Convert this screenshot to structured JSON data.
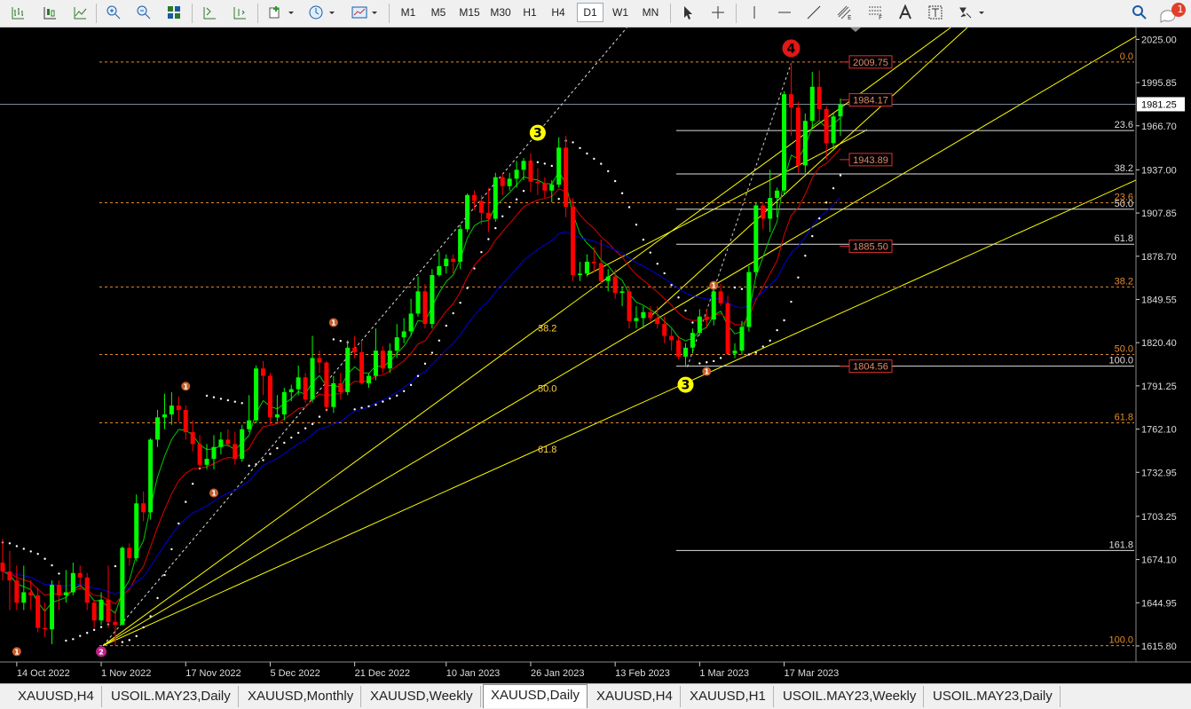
{
  "toolbar": {
    "timeframes": [
      "M1",
      "M5",
      "M15",
      "M30",
      "H1",
      "H4",
      "D1",
      "W1",
      "MN"
    ],
    "active_timeframe": "D1",
    "notification_count": "1",
    "icons": [
      "bar-chart-icon",
      "candle-chart-icon",
      "line-chart-icon",
      "zoom-in-icon",
      "zoom-out-icon",
      "tile-windows-icon",
      "auto-scroll-icon",
      "chart-shift-icon",
      "indicators-icon",
      "periodicity-icon",
      "templates-icon",
      "cursor-icon",
      "crosshair-icon",
      "vertical-line-icon",
      "horizontal-line-icon",
      "trendline-icon",
      "equidistant-channel-icon",
      "fibonacci-icon",
      "text-icon",
      "text-label-icon",
      "shapes-icon",
      "search-icon",
      "notification-icon"
    ]
  },
  "chart": {
    "colors": {
      "background": "#000000",
      "bull": "#00ff00",
      "bear": "#ff0000",
      "ma_fast": "#00cc00",
      "ma_mid": "#e00000",
      "ma_slow": "#0000dd",
      "trendline": "#ffff00",
      "fib": "#e38a2c",
      "sar": "#ffffff"
    },
    "price_axis": [
      "2025.00",
      "1995.85",
      "1966.70",
      "1937.00",
      "1907.85",
      "1878.70",
      "1849.55",
      "1820.40",
      "1791.25",
      "1762.10",
      "1732.95",
      "1703.25",
      "1674.10",
      "1644.95",
      "1615.80"
    ],
    "current_price": "1981.25",
    "date_axis": [
      "14 Oct 2022",
      "1 Nov 2022",
      "17 Nov 2022",
      "5 Dec 2022",
      "21 Dec 2022",
      "10 Jan 2023",
      "26 Jan 2023",
      "13 Feb 2023",
      "1 Mar 2023",
      "17 Mar 2023"
    ],
    "price_tags": [
      {
        "text": "2009.75",
        "price": 2009.75
      },
      {
        "text": "1984.17",
        "price": 1984.17
      },
      {
        "text": "1943.89",
        "price": 1943.89
      },
      {
        "text": "1885.50",
        "price": 1885.5
      },
      {
        "text": "1804.56",
        "price": 1804.56
      }
    ],
    "fib_left_levels": [
      {
        "text": "0.0",
        "price": 2009.75
      },
      {
        "text": "23.6",
        "price": 1914.8
      },
      {
        "text": "38.2",
        "price": 1858
      },
      {
        "text": "50.0",
        "price": 1812.4
      },
      {
        "text": "61.8",
        "price": 1766.3
      },
      {
        "text": "100.0",
        "price": 1616
      }
    ],
    "fib_right_levels": [
      {
        "text": "23.6",
        "price": 1963.5
      },
      {
        "text": "38.2",
        "price": 1934.2
      },
      {
        "text": "50.0",
        "price": 1910.4
      },
      {
        "text": "61.8",
        "price": 1886.8
      },
      {
        "text": "100.0",
        "price": 1804.56
      },
      {
        "text": "161.8",
        "price": 1680.2
      }
    ],
    "fan_labels": [
      "38.2",
      "50.0",
      "61.8"
    ],
    "wave_labels": [
      {
        "text": "3",
        "kind": "yellow",
        "date": "27 Jan 2023",
        "price": 1962
      },
      {
        "text": "4",
        "kind": "red",
        "date": "20 Mar 2023",
        "price": 2019
      },
      {
        "text": "3",
        "kind": "yellow",
        "date": "27 Feb 2023",
        "price": 1792
      },
      {
        "text": "2",
        "kind": "magenta",
        "date": "1 Nov 2022",
        "price": 1612
      },
      {
        "text": "1",
        "kind": "orange",
        "date": "14 Oct 2022",
        "price": 1612
      },
      {
        "text": "1",
        "kind": "orange",
        "date": "17 Nov 2022",
        "price": 1791
      },
      {
        "text": "1",
        "kind": "orange",
        "date": "23 Nov 2022",
        "price": 1719
      },
      {
        "text": "1",
        "kind": "orange",
        "date": "16 Dec 2022",
        "price": 1834
      },
      {
        "text": "1",
        "kind": "orange",
        "date": "2 Mar 2023",
        "price": 1801
      },
      {
        "text": "1",
        "kind": "orange",
        "date": "3 Mar 2023",
        "price": 1859
      }
    ]
  },
  "chart_data": {
    "type": "candlestick",
    "symbol": "XAUUSD",
    "timeframe": "D1",
    "ylim": [
      1605,
      2033
    ],
    "x_start": "12 Oct 2022",
    "x_end": "29 Mar 2023",
    "series": [
      {
        "name": "",
        "values": [
          [
            "12 Oct 2022",
            1672,
            1688,
            1660,
            1666
          ],
          [
            "13 Oct 2022",
            1666,
            1680,
            1640,
            1660
          ],
          [
            "14 Oct 2022",
            1660,
            1670,
            1640,
            1645
          ],
          [
            "17 Oct 2022",
            1645,
            1670,
            1640,
            1652
          ],
          [
            "18 Oct 2022",
            1652,
            1660,
            1640,
            1650
          ],
          [
            "19 Oct 2022",
            1650,
            1655,
            1625,
            1628
          ],
          [
            "20 Oct 2022",
            1628,
            1645,
            1622,
            1627
          ],
          [
            "21 Oct 2022",
            1627,
            1660,
            1617,
            1657
          ],
          [
            "24 Oct 2022",
            1657,
            1660,
            1640,
            1650
          ],
          [
            "25 Oct 2022",
            1650,
            1667,
            1645,
            1652
          ],
          [
            "26 Oct 2022",
            1652,
            1672,
            1650,
            1665
          ],
          [
            "27 Oct 2022",
            1665,
            1670,
            1655,
            1662
          ],
          [
            "28 Oct 2022",
            1662,
            1665,
            1640,
            1645
          ],
          [
            "31 Oct 2022",
            1645,
            1647,
            1628,
            1633
          ],
          [
            "1 Nov 2022",
            1633,
            1652,
            1630,
            1647
          ],
          [
            "2 Nov 2022",
            1647,
            1670,
            1628,
            1632
          ],
          [
            "3 Nov 2022",
            1632,
            1640,
            1616,
            1630
          ],
          [
            "4 Nov 2022",
            1630,
            1683,
            1630,
            1682
          ],
          [
            "7 Nov 2022",
            1682,
            1685,
            1670,
            1675
          ],
          [
            "8 Nov 2022",
            1675,
            1718,
            1673,
            1712
          ],
          [
            "9 Nov 2022",
            1712,
            1720,
            1700,
            1706
          ],
          [
            "10 Nov 2022",
            1706,
            1756,
            1701,
            1755
          ],
          [
            "11 Nov 2022",
            1755,
            1775,
            1750,
            1770
          ],
          [
            "14 Nov 2022",
            1770,
            1786,
            1762,
            1772
          ],
          [
            "15 Nov 2022",
            1772,
            1787,
            1765,
            1778
          ],
          [
            "16 Nov 2022",
            1778,
            1784,
            1767,
            1775
          ],
          [
            "17 Nov 2022",
            1775,
            1778,
            1755,
            1760
          ],
          [
            "18 Nov 2022",
            1760,
            1768,
            1747,
            1752
          ],
          [
            "21 Nov 2022",
            1752,
            1758,
            1735,
            1738
          ],
          [
            "22 Nov 2022",
            1738,
            1752,
            1735,
            1742
          ],
          [
            "23 Nov 2022",
            1742,
            1758,
            1735,
            1750
          ],
          [
            "24 Nov 2022",
            1750,
            1760,
            1745,
            1755
          ],
          [
            "25 Nov 2022",
            1755,
            1762,
            1750,
            1752
          ],
          [
            "28 Nov 2022",
            1752,
            1760,
            1738,
            1742
          ],
          [
            "29 Nov 2022",
            1742,
            1765,
            1740,
            1762
          ],
          [
            "30 Nov 2022",
            1762,
            1785,
            1760,
            1768
          ],
          [
            "1 Dec 2022",
            1768,
            1805,
            1766,
            1803
          ],
          [
            "2 Dec 2022",
            1803,
            1808,
            1785,
            1798
          ],
          [
            "5 Dec 2022",
            1798,
            1800,
            1765,
            1770
          ],
          [
            "6 Dec 2022",
            1770,
            1785,
            1767,
            1772
          ],
          [
            "7 Dec 2022",
            1772,
            1790,
            1768,
            1787
          ],
          [
            "8 Dec 2022",
            1787,
            1792,
            1781,
            1789
          ],
          [
            "9 Dec 2022",
            1789,
            1805,
            1785,
            1797
          ],
          [
            "12 Dec 2022",
            1797,
            1800,
            1780,
            1782
          ],
          [
            "13 Dec 2022",
            1782,
            1825,
            1780,
            1810
          ],
          [
            "14 Dec 2022",
            1810,
            1815,
            1800,
            1807
          ],
          [
            "15 Dec 2022",
            1807,
            1808,
            1774,
            1777
          ],
          [
            "16 Dec 2022",
            1777,
            1798,
            1773,
            1793
          ],
          [
            "19 Dec 2022",
            1793,
            1800,
            1782,
            1787
          ],
          [
            "20 Dec 2022",
            1787,
            1822,
            1785,
            1817
          ],
          [
            "21 Dec 2022",
            1817,
            1825,
            1810,
            1814
          ],
          [
            "22 Dec 2022",
            1814,
            1822,
            1792,
            1793
          ],
          [
            "23 Dec 2022",
            1793,
            1800,
            1790,
            1798
          ],
          [
            "27 Dec 2022",
            1798,
            1830,
            1795,
            1815
          ],
          [
            "28 Dec 2022",
            1815,
            1818,
            1800,
            1803
          ],
          [
            "29 Dec 2022",
            1803,
            1820,
            1800,
            1815
          ],
          [
            "30 Dec 2022",
            1815,
            1833,
            1810,
            1824
          ],
          [
            "2 Jan 2023",
            1824,
            1837,
            1820,
            1828
          ],
          [
            "3 Jan 2023",
            1828,
            1850,
            1825,
            1840
          ],
          [
            "4 Jan 2023",
            1840,
            1865,
            1838,
            1855
          ],
          [
            "5 Jan 2023",
            1855,
            1860,
            1830,
            1833
          ],
          [
            "6 Jan 2023",
            1833,
            1870,
            1830,
            1866
          ],
          [
            "9 Jan 2023",
            1866,
            1882,
            1865,
            1872
          ],
          [
            "10 Jan 2023",
            1872,
            1880,
            1867,
            1877
          ],
          [
            "11 Jan 2023",
            1877,
            1880,
            1867,
            1875
          ],
          [
            "12 Jan 2023",
            1875,
            1900,
            1870,
            1897
          ],
          [
            "13 Jan 2023",
            1897,
            1921,
            1895,
            1920
          ],
          [
            "16 Jan 2023",
            1920,
            1923,
            1910,
            1916
          ],
          [
            "17 Jan 2023",
            1916,
            1920,
            1900,
            1908
          ],
          [
            "18 Jan 2023",
            1908,
            1925,
            1895,
            1904
          ],
          [
            "19 Jan 2023",
            1904,
            1935,
            1902,
            1932
          ],
          [
            "20 Jan 2023",
            1932,
            1935,
            1920,
            1926
          ],
          [
            "23 Jan 2023",
            1926,
            1935,
            1923,
            1931
          ],
          [
            "24 Jan 2023",
            1931,
            1943,
            1925,
            1937
          ],
          [
            "25 Jan 2023",
            1937,
            1945,
            1930,
            1943
          ],
          [
            "26 Jan 2023",
            1943,
            1948,
            1922,
            1929
          ],
          [
            "27 Jan 2023",
            1929,
            1938,
            1920,
            1928
          ],
          [
            "30 Jan 2023",
            1928,
            1932,
            1918,
            1923
          ],
          [
            "31 Jan 2023",
            1923,
            1930,
            1915,
            1927
          ],
          [
            "1 Feb 2023",
            1927,
            1959,
            1925,
            1952
          ],
          [
            "2 Feb 2023",
            1952,
            1960,
            1905,
            1912
          ],
          [
            "3 Feb 2023",
            1912,
            1918,
            1862,
            1866
          ],
          [
            "6 Feb 2023",
            1866,
            1875,
            1862,
            1867
          ],
          [
            "7 Feb 2023",
            1867,
            1880,
            1865,
            1875
          ],
          [
            "8 Feb 2023",
            1875,
            1885,
            1868,
            1874
          ],
          [
            "9 Feb 2023",
            1874,
            1890,
            1860,
            1862
          ],
          [
            "10 Feb 2023",
            1862,
            1870,
            1855,
            1865
          ],
          [
            "13 Feb 2023",
            1865,
            1870,
            1850,
            1854
          ],
          [
            "14 Feb 2023",
            1854,
            1858,
            1845,
            1855
          ],
          [
            "15 Feb 2023",
            1855,
            1858,
            1830,
            1835
          ],
          [
            "16 Feb 2023",
            1835,
            1845,
            1830,
            1837
          ],
          [
            "17 Feb 2023",
            1837,
            1845,
            1830,
            1841
          ],
          [
            "20 Feb 2023",
            1841,
            1845,
            1835,
            1837
          ],
          [
            "21 Feb 2023",
            1837,
            1845,
            1830,
            1833
          ],
          [
            "22 Feb 2023",
            1833,
            1838,
            1820,
            1825
          ],
          [
            "23 Feb 2023",
            1825,
            1830,
            1815,
            1822
          ],
          [
            "24 Feb 2023",
            1822,
            1825,
            1809,
            1811
          ],
          [
            "27 Feb 2023",
            1811,
            1820,
            1804,
            1817
          ],
          [
            "28 Feb 2023",
            1817,
            1830,
            1813,
            1827
          ],
          [
            "1 Mar 2023",
            1827,
            1843,
            1825,
            1838
          ],
          [
            "2 Mar 2023",
            1838,
            1843,
            1830,
            1836
          ],
          [
            "3 Mar 2023",
            1836,
            1858,
            1832,
            1855
          ],
          [
            "6 Mar 2023",
            1855,
            1860,
            1845,
            1847
          ],
          [
            "7 Mar 2023",
            1847,
            1852,
            1812,
            1813
          ],
          [
            "8 Mar 2023",
            1813,
            1820,
            1810,
            1815
          ],
          [
            "9 Mar 2023",
            1815,
            1835,
            1812,
            1831
          ],
          [
            "10 Mar 2023",
            1831,
            1872,
            1828,
            1868
          ],
          [
            "13 Mar 2023",
            1868,
            1915,
            1865,
            1913
          ],
          [
            "14 Mar 2023",
            1913,
            1915,
            1897,
            1904
          ],
          [
            "15 Mar 2023",
            1904,
            1937,
            1895,
            1918
          ],
          [
            "16 Mar 2023",
            1918,
            1925,
            1905,
            1923
          ],
          [
            "17 Mar 2023",
            1923,
            1990,
            1920,
            1988
          ],
          [
            "20 Mar 2023",
            1988,
            2009,
            1960,
            1979
          ],
          [
            "21 Mar 2023",
            1979,
            1983,
            1935,
            1940
          ],
          [
            "22 Mar 2023",
            1940,
            1975,
            1935,
            1970
          ],
          [
            "23 Mar 2023",
            1970,
            2003,
            1965,
            1993
          ],
          [
            "24 Mar 2023",
            1993,
            2004,
            1970,
            1978
          ],
          [
            "27 Mar 2023",
            1978,
            1980,
            1944,
            1955
          ],
          [
            "28 Mar 2023",
            1955,
            1975,
            1950,
            1973
          ],
          [
            "29 Mar 2023",
            1973,
            1985,
            1960,
            1981
          ]
        ]
      }
    ]
  },
  "tabs": [
    {
      "label": "XAUUSD,H4",
      "active": false
    },
    {
      "label": "USOIL.MAY23,Daily",
      "active": false
    },
    {
      "label": "XAUUSD,Monthly",
      "active": false
    },
    {
      "label": "XAUUSD,Weekly",
      "active": false
    },
    {
      "label": "XAUUSD,Daily",
      "active": true
    },
    {
      "label": "XAUUSD,H4",
      "active": false
    },
    {
      "label": "XAUUSD,H1",
      "active": false
    },
    {
      "label": "USOIL.MAY23,Weekly",
      "active": false
    },
    {
      "label": "USOIL.MAY23,Daily",
      "active": false
    }
  ]
}
